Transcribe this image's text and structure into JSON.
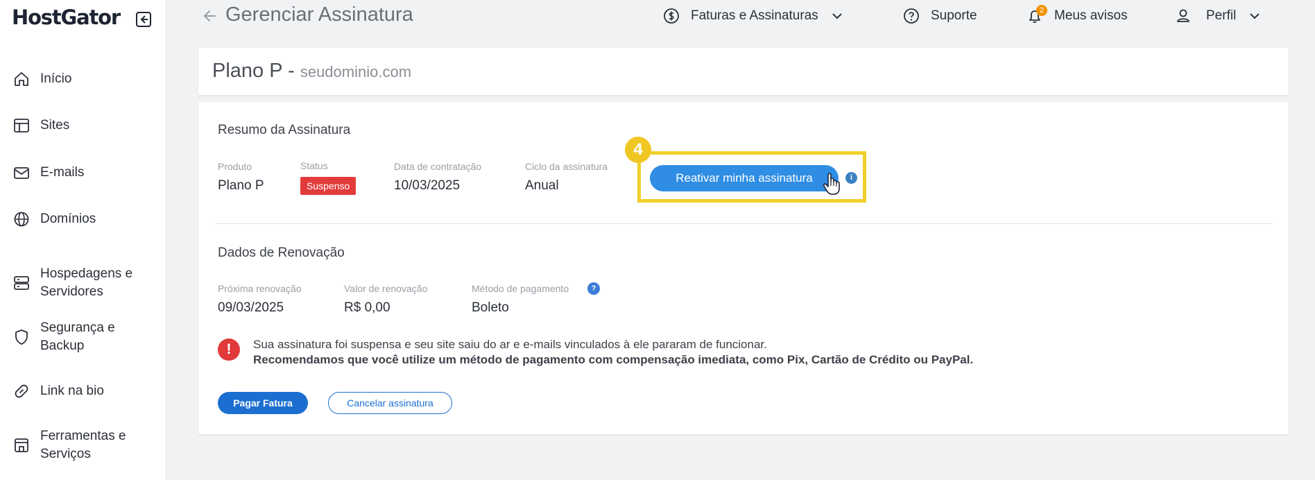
{
  "sidebar": {
    "logo": "HostGator",
    "items": [
      {
        "label": "Início",
        "icon": "home-icon"
      },
      {
        "label": "Sites",
        "icon": "layout-icon"
      },
      {
        "label": "E-mails",
        "icon": "mail-icon"
      },
      {
        "label": "Domínios",
        "icon": "globe-icon"
      },
      {
        "label": "Hospedagens e\nServidores",
        "icon": "server-icon"
      },
      {
        "label": "Segurança e\nBackup",
        "icon": "shield-icon"
      },
      {
        "label": "Link na bio",
        "icon": "link-icon"
      },
      {
        "label": "Ferramentas e\nServiços",
        "icon": "store-icon"
      }
    ]
  },
  "header": {
    "title": "Gerenciar Assinatura",
    "billing": "Faturas e Assinaturas",
    "support": "Suporte",
    "notices": "Meus avisos",
    "notices_count": "2",
    "profile": "Perfil"
  },
  "plan": {
    "name": "Plano P",
    "separator": " - ",
    "domain": "seudominio.com"
  },
  "summary": {
    "title": "Resumo da Assinatura",
    "product_label": "Produto",
    "product_value": "Plano P",
    "status_label": "Status",
    "status_value": "Suspenso",
    "date_label": "Data de contratação",
    "date_value": "10/03/2025",
    "cycle_label": "Ciclo da assinatura",
    "cycle_value": "Anual",
    "reactivate_button": "Reativar minha assinatura",
    "step_number": "4"
  },
  "renewal": {
    "title": "Dados de Renovação",
    "next_label": "Próxima renovação",
    "next_value": "09/03/2025",
    "amount_label": "Valor de renovação",
    "amount_value": "R$ 0,00",
    "method_label": "Método de pagamento",
    "method_value": "Boleto"
  },
  "alert": {
    "line1": "Sua assinatura foi suspensa e seu site saiu do ar e e-mails vinculados à ele pararam de funcionar.",
    "line2": "Recomendamos que você utilize um método de pagamento com compensação imediata, como Pix, Cartão de Crédito ou PayPal."
  },
  "actions": {
    "pay": "Pagar Fatura",
    "cancel": "Cancelar assinatura"
  },
  "colors": {
    "primary": "#2f8de4",
    "button_dark": "#1c6fd0",
    "danger": "#e23b3b",
    "highlight": "#f0d02a"
  }
}
